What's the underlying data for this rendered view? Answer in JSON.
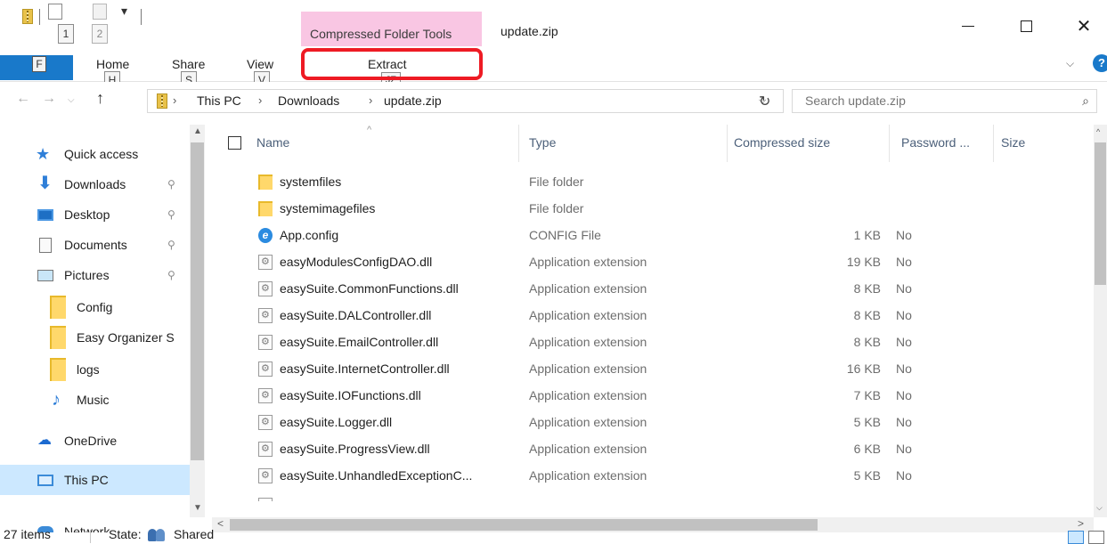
{
  "titlebar": {
    "contextual_tab": "Compressed Folder Tools",
    "title": "update.zip",
    "keytips": {
      "qat1": "1",
      "qat2": "2"
    },
    "qat_dropdown": "▾",
    "minimize": "",
    "maximize": "",
    "close": "✕"
  },
  "ribbon": {
    "file_keytip": "F",
    "tabs": [
      {
        "label": "Home",
        "keytip": "H"
      },
      {
        "label": "Share",
        "keytip": "S"
      },
      {
        "label": "View",
        "keytip": "V"
      },
      {
        "label": "Extract",
        "keytip": "JZ"
      }
    ],
    "collapse": "⌵",
    "help": "?"
  },
  "navigation": {
    "back": "←",
    "forward": "→",
    "recent": "⌵",
    "up": "↑",
    "breadcrumb": [
      "This PC",
      "Downloads",
      "update.zip"
    ],
    "crumb_separator": "›",
    "address_dropdown": "⌵",
    "refresh": "↻",
    "search_placeholder": "Search update.zip",
    "search_icon": "⌕"
  },
  "sidebar": {
    "items": [
      {
        "label": "Quick access",
        "icon": "star-icon",
        "pinned": false
      },
      {
        "label": "Downloads",
        "icon": "download-icon",
        "pinned": true
      },
      {
        "label": "Desktop",
        "icon": "desktop-icon",
        "pinned": true
      },
      {
        "label": "Documents",
        "icon": "documents-icon",
        "pinned": true
      },
      {
        "label": "Pictures",
        "icon": "pictures-icon",
        "pinned": true
      },
      {
        "label": "Config",
        "icon": "folder-icon",
        "pinned": false
      },
      {
        "label": "Easy Organizer S",
        "icon": "folder-icon",
        "pinned": false
      },
      {
        "label": "logs",
        "icon": "folder-icon",
        "pinned": false
      },
      {
        "label": "Music",
        "icon": "music-icon",
        "pinned": false
      },
      {
        "label": "OneDrive",
        "icon": "cloud-icon",
        "pinned": false
      },
      {
        "label": "This PC",
        "icon": "computer-icon",
        "pinned": false,
        "selected": true
      }
    ],
    "partial_item": "Network",
    "pin_glyph": "⚲",
    "scroll_up": "▲",
    "scroll_down": "▼"
  },
  "file_list": {
    "columns": {
      "name": "Name",
      "type": "Type",
      "compressed_size": "Compressed size",
      "password": "Password ...",
      "size": "Size"
    },
    "sort_arrow": "^",
    "rows": [
      {
        "name": "systemfiles",
        "type": "File folder",
        "size": "",
        "password": "",
        "icon": "folder-icon"
      },
      {
        "name": "systemimagefiles",
        "type": "File folder",
        "size": "",
        "password": "",
        "icon": "folder-icon"
      },
      {
        "name": "App.config",
        "type": "CONFIG File",
        "size": "1 KB",
        "password": "No",
        "icon": "ie-file-icon"
      },
      {
        "name": "easyModulesConfigDAO.dll",
        "type": "Application extension",
        "size": "19 KB",
        "password": "No",
        "icon": "dll-icon"
      },
      {
        "name": "easySuite.CommonFunctions.dll",
        "type": "Application extension",
        "size": "8 KB",
        "password": "No",
        "icon": "dll-icon"
      },
      {
        "name": "easySuite.DALController.dll",
        "type": "Application extension",
        "size": "8 KB",
        "password": "No",
        "icon": "dll-icon"
      },
      {
        "name": "easySuite.EmailController.dll",
        "type": "Application extension",
        "size": "8 KB",
        "password": "No",
        "icon": "dll-icon"
      },
      {
        "name": "easySuite.InternetController.dll",
        "type": "Application extension",
        "size": "16 KB",
        "password": "No",
        "icon": "dll-icon"
      },
      {
        "name": "easySuite.IOFunctions.dll",
        "type": "Application extension",
        "size": "7 KB",
        "password": "No",
        "icon": "dll-icon"
      },
      {
        "name": "easySuite.Logger.dll",
        "type": "Application extension",
        "size": "5 KB",
        "password": "No",
        "icon": "dll-icon"
      },
      {
        "name": "easySuite.ProgressView.dll",
        "type": "Application extension",
        "size": "6 KB",
        "password": "No",
        "icon": "dll-icon"
      },
      {
        "name": "easySuite.UnhandledExceptionC...",
        "type": "Application extension",
        "size": "5 KB",
        "password": "No",
        "icon": "dll-icon"
      }
    ],
    "scroll_up": "^",
    "scroll_down": "⌵",
    "scroll_left": "<",
    "scroll_right": ">"
  },
  "status": {
    "items": "27 items",
    "state_label": "State:",
    "shared": "Shared"
  },
  "colors": {
    "file_tab": "#1979ca",
    "contextual_tab": "#f9c6e3",
    "highlight_ring": "#ee1b24",
    "selected_nav": "#cce8ff"
  }
}
